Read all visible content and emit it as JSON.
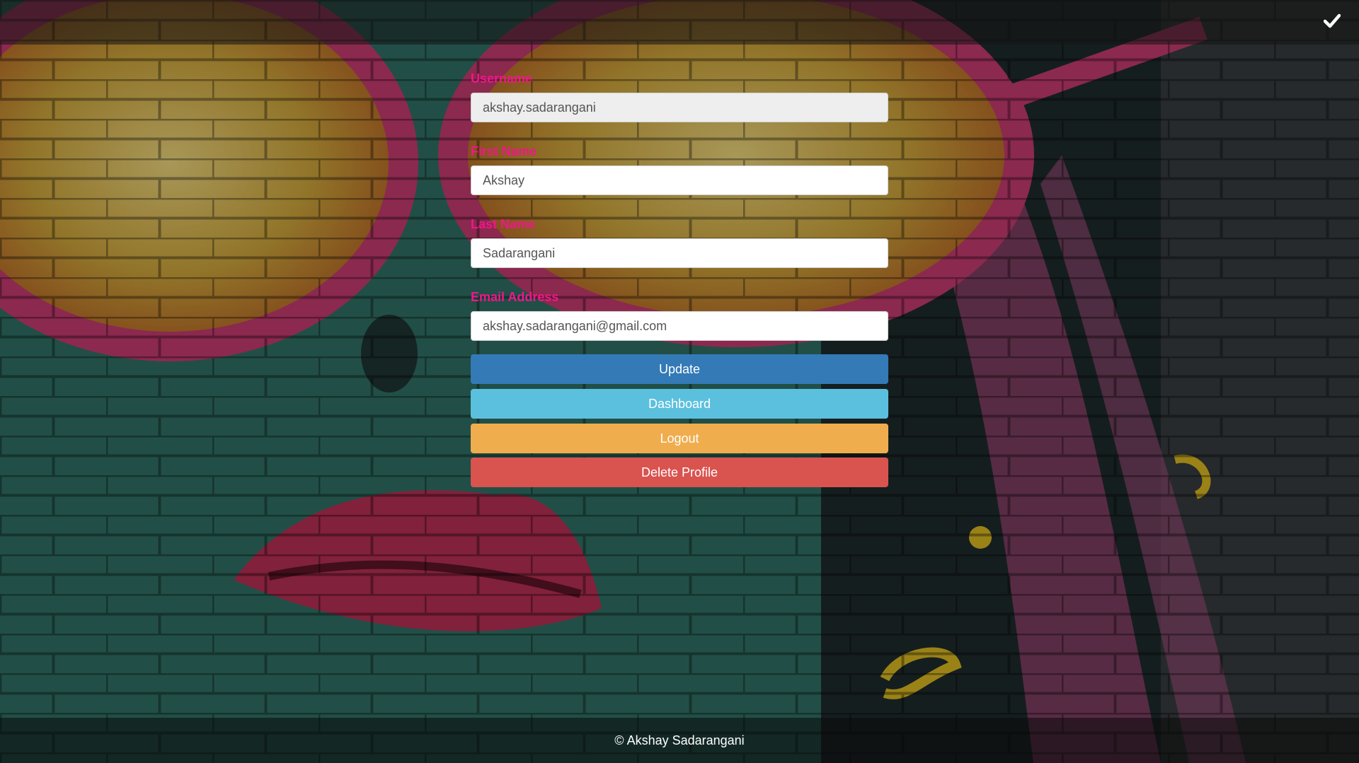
{
  "form": {
    "username": {
      "label": "Username",
      "value": "akshay.sadarangani"
    },
    "first_name": {
      "label": "First Name",
      "value": "Akshay"
    },
    "last_name": {
      "label": "Last Name",
      "value": "Sadarangani"
    },
    "email": {
      "label": "Email Address",
      "value": "akshay.sadarangani@gmail.com"
    }
  },
  "buttons": {
    "update": "Update",
    "dashboard": "Dashboard",
    "logout": "Logout",
    "delete": "Delete Profile"
  },
  "topbar": {
    "icon": "check-icon"
  },
  "footer": {
    "text": "© Akshay Sadarangani"
  },
  "colors": {
    "label": "#f0168a",
    "update": "#337ab7",
    "dashboard": "#5bc0de",
    "logout": "#f0ad4e",
    "delete": "#d9534f"
  }
}
